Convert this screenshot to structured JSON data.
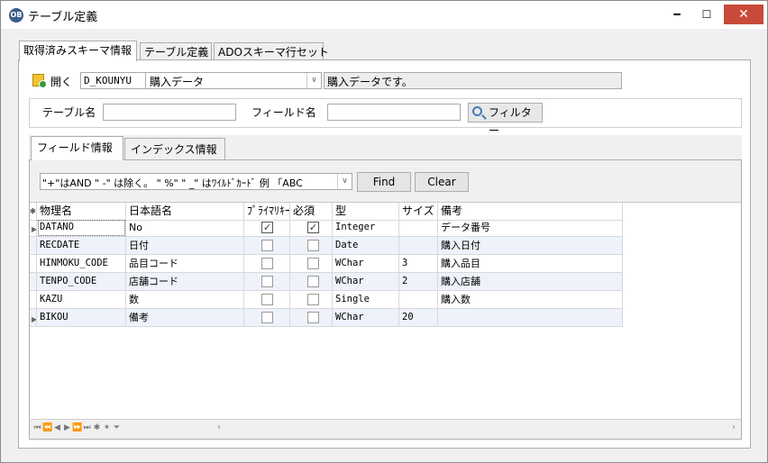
{
  "window": {
    "title": "テーブル定義",
    "app_icon": "OB",
    "minimize_glyph": "━",
    "maximize_glyph": "☐",
    "close_glyph": "✕"
  },
  "main_tabs": [
    "取得済みスキーマ情報",
    "テーブル定義",
    "ADOスキーマ行セット"
  ],
  "open": {
    "label": "開く",
    "combo_code": "D_KOUNYU",
    "combo_name": "購入データ",
    "description": "購入データです。",
    "combo_arrow": "∨"
  },
  "filter": {
    "table_label": "テーブル名",
    "table_value": "",
    "field_label": "フィールド名",
    "field_value": "",
    "button_label": "フィルター"
  },
  "inner_tabs": [
    "フィールド情報",
    "インデックス情報"
  ],
  "search": {
    "hint": "\"+\"はAND \" -\" は除く。 \" %\"   \" _\" はﾜｲﾙﾄﾞｶｰﾄﾞ  例 「ABC",
    "find_label": "Find",
    "clear_label": "Clear",
    "combo_arrow": "∨"
  },
  "grid": {
    "new_row_glyph": "✻",
    "columns": [
      "物理名",
      "日本語名",
      "ﾌﾟﾗｲﾏﾘｷｰ",
      "必須",
      "型",
      "サイズ",
      "備考"
    ],
    "rows": [
      {
        "physical": "DATANO",
        "japanese": "No",
        "primary_key": true,
        "required": true,
        "type": "Integer",
        "size": "",
        "remarks": "データ番号"
      },
      {
        "physical": "RECDATE",
        "japanese": "日付",
        "primary_key": false,
        "required": false,
        "type": "Date",
        "size": "",
        "remarks": "購入日付"
      },
      {
        "physical": "HINMOKU_CODE",
        "japanese": "品目コード",
        "primary_key": false,
        "required": false,
        "type": "WChar",
        "size": "3",
        "remarks": "購入品目"
      },
      {
        "physical": "TENPO_CODE",
        "japanese": "店舗コード",
        "primary_key": false,
        "required": false,
        "type": "WChar",
        "size": "2",
        "remarks": "購入店舗"
      },
      {
        "physical": "KAZU",
        "japanese": "数",
        "primary_key": false,
        "required": false,
        "type": "Single",
        "size": "",
        "remarks": "購入数"
      },
      {
        "physical": "BIKOU",
        "japanese": "備考",
        "primary_key": false,
        "required": false,
        "type": "WChar",
        "size": "20",
        "remarks": ""
      }
    ]
  },
  "navigator": {
    "glyphs": [
      "⏮",
      "⏪",
      "◀",
      "▶",
      "⏩",
      "⏭",
      "✱",
      "✶",
      "⏷"
    ],
    "scroll_left": "‹",
    "scroll_right": "›"
  },
  "colors": {
    "close_button": "#c94a3a",
    "row_alt": "#eef2fa",
    "row_pointer_icon": "triangle-right"
  }
}
